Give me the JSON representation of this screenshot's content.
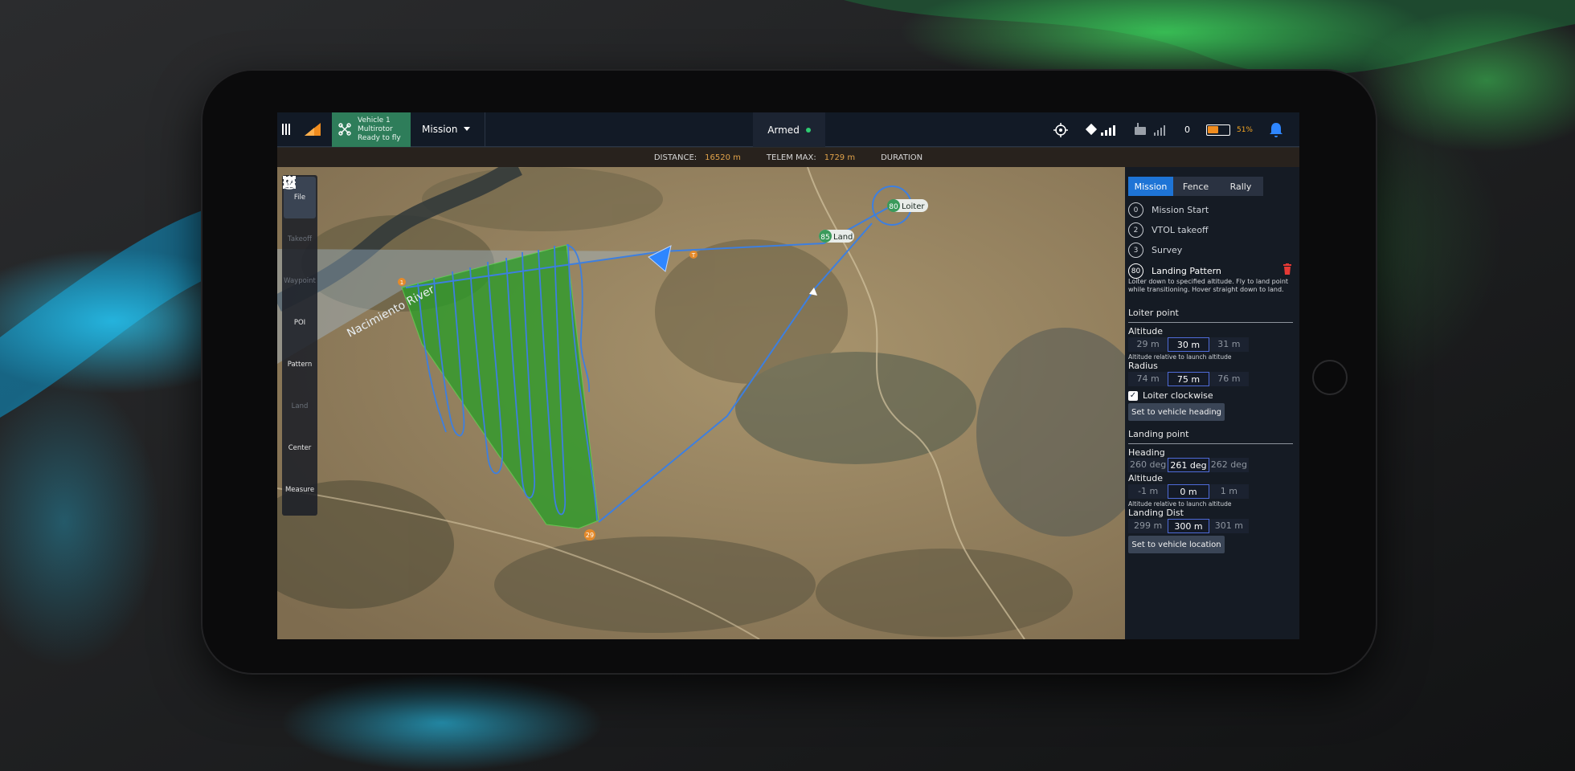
{
  "topbar": {
    "vehicle_line1": "Vehicle 1",
    "vehicle_line2": "Multirotor",
    "vehicle_line3": "Ready to fly",
    "mission_label": "Mission",
    "armed_label": "Armed",
    "rc_count": "0",
    "battery_pct": "51%",
    "battery_level": 0.51
  },
  "status": {
    "distance_label": "DISTANCE:",
    "distance_value": "16520 m",
    "telem_label": "TELEM MAX:",
    "telem_value": "1729 m",
    "duration_label": "DURATION"
  },
  "toolbar": {
    "file": "File",
    "takeoff": "Takeoff",
    "waypoint": "Waypoint",
    "poi": "POI",
    "pattern": "Pattern",
    "land": "Land",
    "center": "Center",
    "measure": "Measure"
  },
  "map": {
    "river_label": "Nacimiento River",
    "loiter_num": "80",
    "loiter_label": "Loiter",
    "land_num": "85",
    "land_label": "Land",
    "start_num": "29",
    "start_marker": "1",
    "t_marker": "T",
    "survey_color": "#2e9c2a",
    "path_color": "#3d7fe0"
  },
  "panel": {
    "tabs": [
      "Mission",
      "Fence",
      "Rally"
    ],
    "items": [
      {
        "num": "0",
        "label": "Mission Start"
      },
      {
        "num": "2",
        "label": "VTOL takeoff"
      },
      {
        "num": "3",
        "label": "Survey"
      },
      {
        "num": "80",
        "label": "Landing Pattern"
      }
    ],
    "description": "Loiter down to specified altitude. Fly to land point while transitioning. Hover straight down to land.",
    "loiter_section": "Loiter point",
    "altitude_label": "Altitude",
    "altitude_steps": [
      "29 m",
      "30 m",
      "31 m"
    ],
    "altitude_help": "Altitude relative to launch altitude",
    "radius_label": "Radius",
    "radius_steps": [
      "74 m",
      "75 m",
      "76 m"
    ],
    "loiter_cw": "Loiter clockwise",
    "set_heading_btn": "Set to vehicle heading",
    "landing_section": "Landing point",
    "heading_label": "Heading",
    "heading_steps": [
      "260 deg",
      "261 deg",
      "262 deg"
    ],
    "land_alt_label": "Altitude",
    "land_alt_steps": [
      "-1 m",
      "0 m",
      "1 m"
    ],
    "land_alt_help": "Altitude relative to launch altitude",
    "land_dist_label": "Landing Dist",
    "land_dist_steps": [
      "299 m",
      "300 m",
      "301 m"
    ],
    "set_location_btn": "Set to vehicle location"
  }
}
